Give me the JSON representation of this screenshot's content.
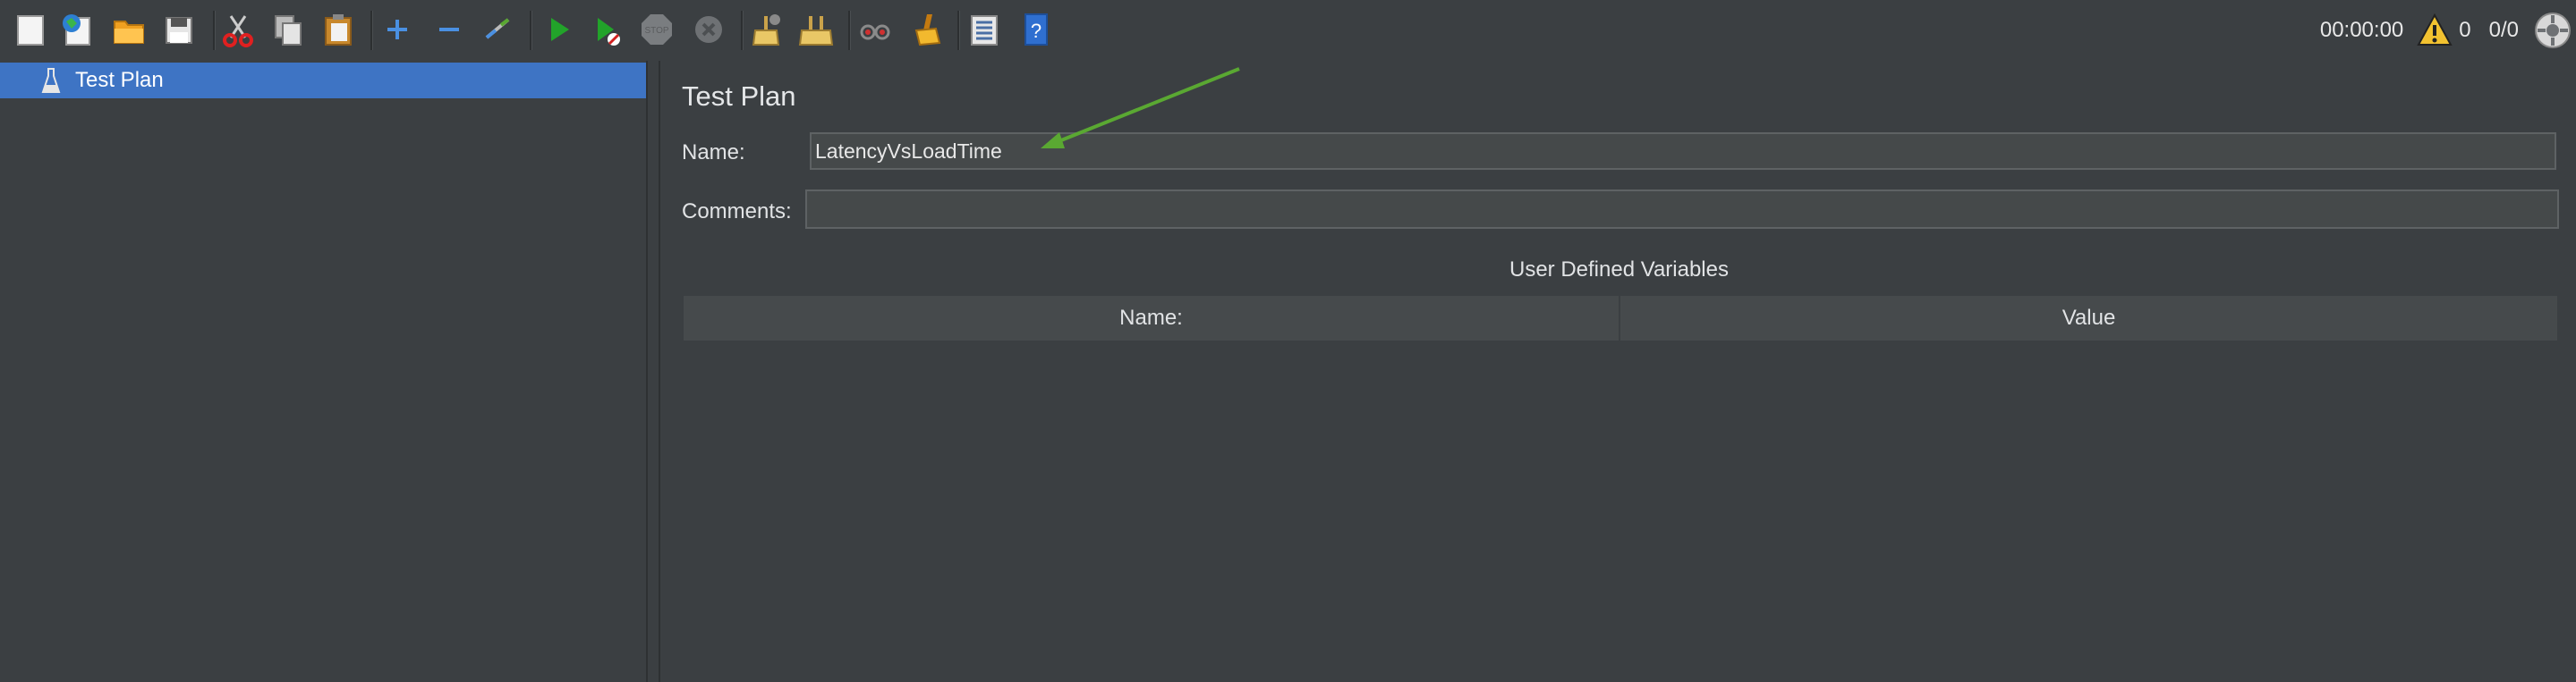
{
  "toolbar": {
    "icons": [
      "new-icon",
      "templates-icon",
      "open-icon",
      "save-icon",
      "cut-icon",
      "copy-icon",
      "paste-icon",
      "expand-icon",
      "collapse-icon",
      "toggle-icon",
      "start-icon",
      "start-no-pauses-icon",
      "stop-icon",
      "shutdown-icon",
      "clear-icon",
      "clear-all-icon",
      "search-icon",
      "reset-search-icon",
      "function-helper-icon",
      "help-icon"
    ],
    "stop_label": "STOP"
  },
  "status": {
    "elapsed_time": "00:00:00",
    "warning_count": "0",
    "threads": "0/0"
  },
  "tree": {
    "selected_item": "Test Plan"
  },
  "editor": {
    "title": "Test Plan",
    "name_label": "Name:",
    "name_value": "LatencyVsLoadTime",
    "comments_label": "Comments:",
    "comments_value": "",
    "udv_title": "User Defined Variables",
    "columns": [
      "Name:",
      "Value"
    ]
  },
  "colors": {
    "background": "#3b3f42",
    "selection": "#3e74c4",
    "arrow": "#5aa832"
  }
}
